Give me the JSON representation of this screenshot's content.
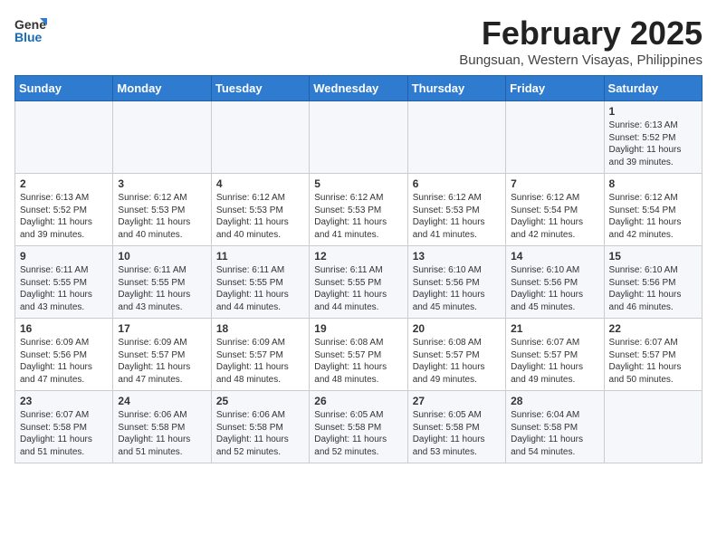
{
  "header": {
    "logo_general": "General",
    "logo_blue": "Blue",
    "month_year": "February 2025",
    "location": "Bungsuan, Western Visayas, Philippines"
  },
  "weekdays": [
    "Sunday",
    "Monday",
    "Tuesday",
    "Wednesday",
    "Thursday",
    "Friday",
    "Saturday"
  ],
  "weeks": [
    [
      {
        "day": "",
        "info": ""
      },
      {
        "day": "",
        "info": ""
      },
      {
        "day": "",
        "info": ""
      },
      {
        "day": "",
        "info": ""
      },
      {
        "day": "",
        "info": ""
      },
      {
        "day": "",
        "info": ""
      },
      {
        "day": "1",
        "info": "Sunrise: 6:13 AM\nSunset: 5:52 PM\nDaylight: 11 hours\nand 39 minutes."
      }
    ],
    [
      {
        "day": "2",
        "info": "Sunrise: 6:13 AM\nSunset: 5:52 PM\nDaylight: 11 hours\nand 39 minutes."
      },
      {
        "day": "3",
        "info": "Sunrise: 6:12 AM\nSunset: 5:53 PM\nDaylight: 11 hours\nand 40 minutes."
      },
      {
        "day": "4",
        "info": "Sunrise: 6:12 AM\nSunset: 5:53 PM\nDaylight: 11 hours\nand 40 minutes."
      },
      {
        "day": "5",
        "info": "Sunrise: 6:12 AM\nSunset: 5:53 PM\nDaylight: 11 hours\nand 41 minutes."
      },
      {
        "day": "6",
        "info": "Sunrise: 6:12 AM\nSunset: 5:53 PM\nDaylight: 11 hours\nand 41 minutes."
      },
      {
        "day": "7",
        "info": "Sunrise: 6:12 AM\nSunset: 5:54 PM\nDaylight: 11 hours\nand 42 minutes."
      },
      {
        "day": "8",
        "info": "Sunrise: 6:12 AM\nSunset: 5:54 PM\nDaylight: 11 hours\nand 42 minutes."
      }
    ],
    [
      {
        "day": "9",
        "info": "Sunrise: 6:11 AM\nSunset: 5:55 PM\nDaylight: 11 hours\nand 43 minutes."
      },
      {
        "day": "10",
        "info": "Sunrise: 6:11 AM\nSunset: 5:55 PM\nDaylight: 11 hours\nand 43 minutes."
      },
      {
        "day": "11",
        "info": "Sunrise: 6:11 AM\nSunset: 5:55 PM\nDaylight: 11 hours\nand 44 minutes."
      },
      {
        "day": "12",
        "info": "Sunrise: 6:11 AM\nSunset: 5:55 PM\nDaylight: 11 hours\nand 44 minutes."
      },
      {
        "day": "13",
        "info": "Sunrise: 6:10 AM\nSunset: 5:56 PM\nDaylight: 11 hours\nand 45 minutes."
      },
      {
        "day": "14",
        "info": "Sunrise: 6:10 AM\nSunset: 5:56 PM\nDaylight: 11 hours\nand 45 minutes."
      },
      {
        "day": "15",
        "info": "Sunrise: 6:10 AM\nSunset: 5:56 PM\nDaylight: 11 hours\nand 46 minutes."
      }
    ],
    [
      {
        "day": "16",
        "info": "Sunrise: 6:09 AM\nSunset: 5:56 PM\nDaylight: 11 hours\nand 47 minutes."
      },
      {
        "day": "17",
        "info": "Sunrise: 6:09 AM\nSunset: 5:57 PM\nDaylight: 11 hours\nand 47 minutes."
      },
      {
        "day": "18",
        "info": "Sunrise: 6:09 AM\nSunset: 5:57 PM\nDaylight: 11 hours\nand 48 minutes."
      },
      {
        "day": "19",
        "info": "Sunrise: 6:08 AM\nSunset: 5:57 PM\nDaylight: 11 hours\nand 48 minutes."
      },
      {
        "day": "20",
        "info": "Sunrise: 6:08 AM\nSunset: 5:57 PM\nDaylight: 11 hours\nand 49 minutes."
      },
      {
        "day": "21",
        "info": "Sunrise: 6:07 AM\nSunset: 5:57 PM\nDaylight: 11 hours\nand 49 minutes."
      },
      {
        "day": "22",
        "info": "Sunrise: 6:07 AM\nSunset: 5:57 PM\nDaylight: 11 hours\nand 50 minutes."
      }
    ],
    [
      {
        "day": "23",
        "info": "Sunrise: 6:07 AM\nSunset: 5:58 PM\nDaylight: 11 hours\nand 51 minutes."
      },
      {
        "day": "24",
        "info": "Sunrise: 6:06 AM\nSunset: 5:58 PM\nDaylight: 11 hours\nand 51 minutes."
      },
      {
        "day": "25",
        "info": "Sunrise: 6:06 AM\nSunset: 5:58 PM\nDaylight: 11 hours\nand 52 minutes."
      },
      {
        "day": "26",
        "info": "Sunrise: 6:05 AM\nSunset: 5:58 PM\nDaylight: 11 hours\nand 52 minutes."
      },
      {
        "day": "27",
        "info": "Sunrise: 6:05 AM\nSunset: 5:58 PM\nDaylight: 11 hours\nand 53 minutes."
      },
      {
        "day": "28",
        "info": "Sunrise: 6:04 AM\nSunset: 5:58 PM\nDaylight: 11 hours\nand 54 minutes."
      },
      {
        "day": "",
        "info": ""
      }
    ]
  ]
}
